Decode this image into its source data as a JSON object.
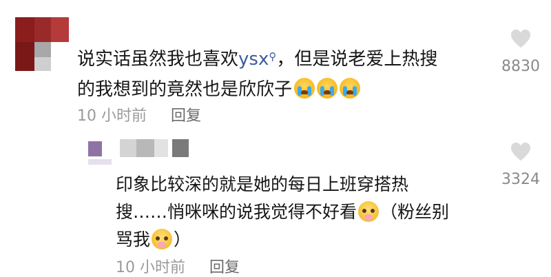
{
  "comment": {
    "text_line1_a": "说实话虽然我也喜欢",
    "mention": "ysx",
    "mention_icon": "search-icon",
    "text_line1_b": "，但是说老爱上热搜",
    "text_line2": "的我想到的竟然也是欣欣子",
    "emoji": "loudly-crying-face",
    "time": "10 小时前",
    "reply_label": "回复",
    "likes": "8830"
  },
  "reply": {
    "text_line1": "印象比较深的就是她的每日上班穿搭热",
    "text_line2": "搜……悄咪咪的说我觉得不好看",
    "text_line2_b": "（粉丝别",
    "text_line3": "骂我",
    "text_line3_b": "）",
    "emoji": "pleading-face",
    "time": "10 小时前",
    "reply_label": "回复",
    "likes": "3324"
  },
  "colors": {
    "mention": "#3b5b9a",
    "meta": "#9a9a9a",
    "like_count": "#8a8a8a",
    "heart": "#d9d9d9"
  }
}
